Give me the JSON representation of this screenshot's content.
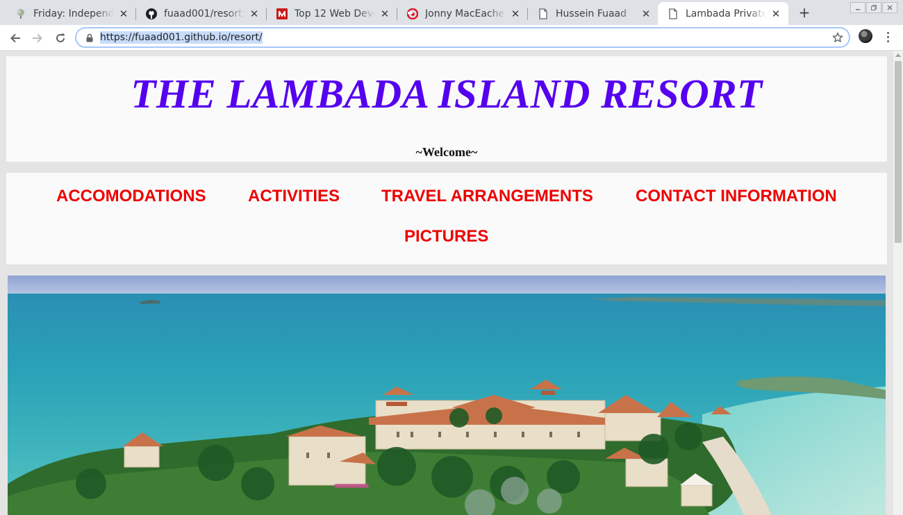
{
  "browser": {
    "tabs": [
      {
        "title": "Friday: Independe",
        "icon": "tree-favicon-icon",
        "active": false
      },
      {
        "title": "fuaad001/resort: l",
        "icon": "github-icon",
        "active": false
      },
      {
        "title": "Top 12 Web Develo",
        "icon": "medium-m-icon",
        "active": false
      },
      {
        "title": "Jonny MacEachern",
        "icon": "red-swirl-icon",
        "active": false
      },
      {
        "title": "Hussein Fuaad",
        "icon": "page-icon",
        "active": false
      },
      {
        "title": "Lambada Private I",
        "icon": "page-icon",
        "active": true
      }
    ],
    "new_tab": "+",
    "tab_close": "✕",
    "url": "https://fuaad001.github.io/resort/"
  },
  "page": {
    "title": "THE LAMBADA ISLAND RESORT",
    "welcome": "~Welcome~",
    "nav": [
      {
        "label": "ACCOMODATIONS"
      },
      {
        "label": "ACTIVITIES"
      },
      {
        "label": "TRAVEL ARRANGEMENTS"
      },
      {
        "label": "CONTACT INFORMATION"
      },
      {
        "label": "PICTURES"
      }
    ]
  },
  "colors": {
    "title": "#5500ee",
    "nav_link": "#ee0000",
    "panel": "#fafafa",
    "page_background": "#e4e4e4"
  }
}
